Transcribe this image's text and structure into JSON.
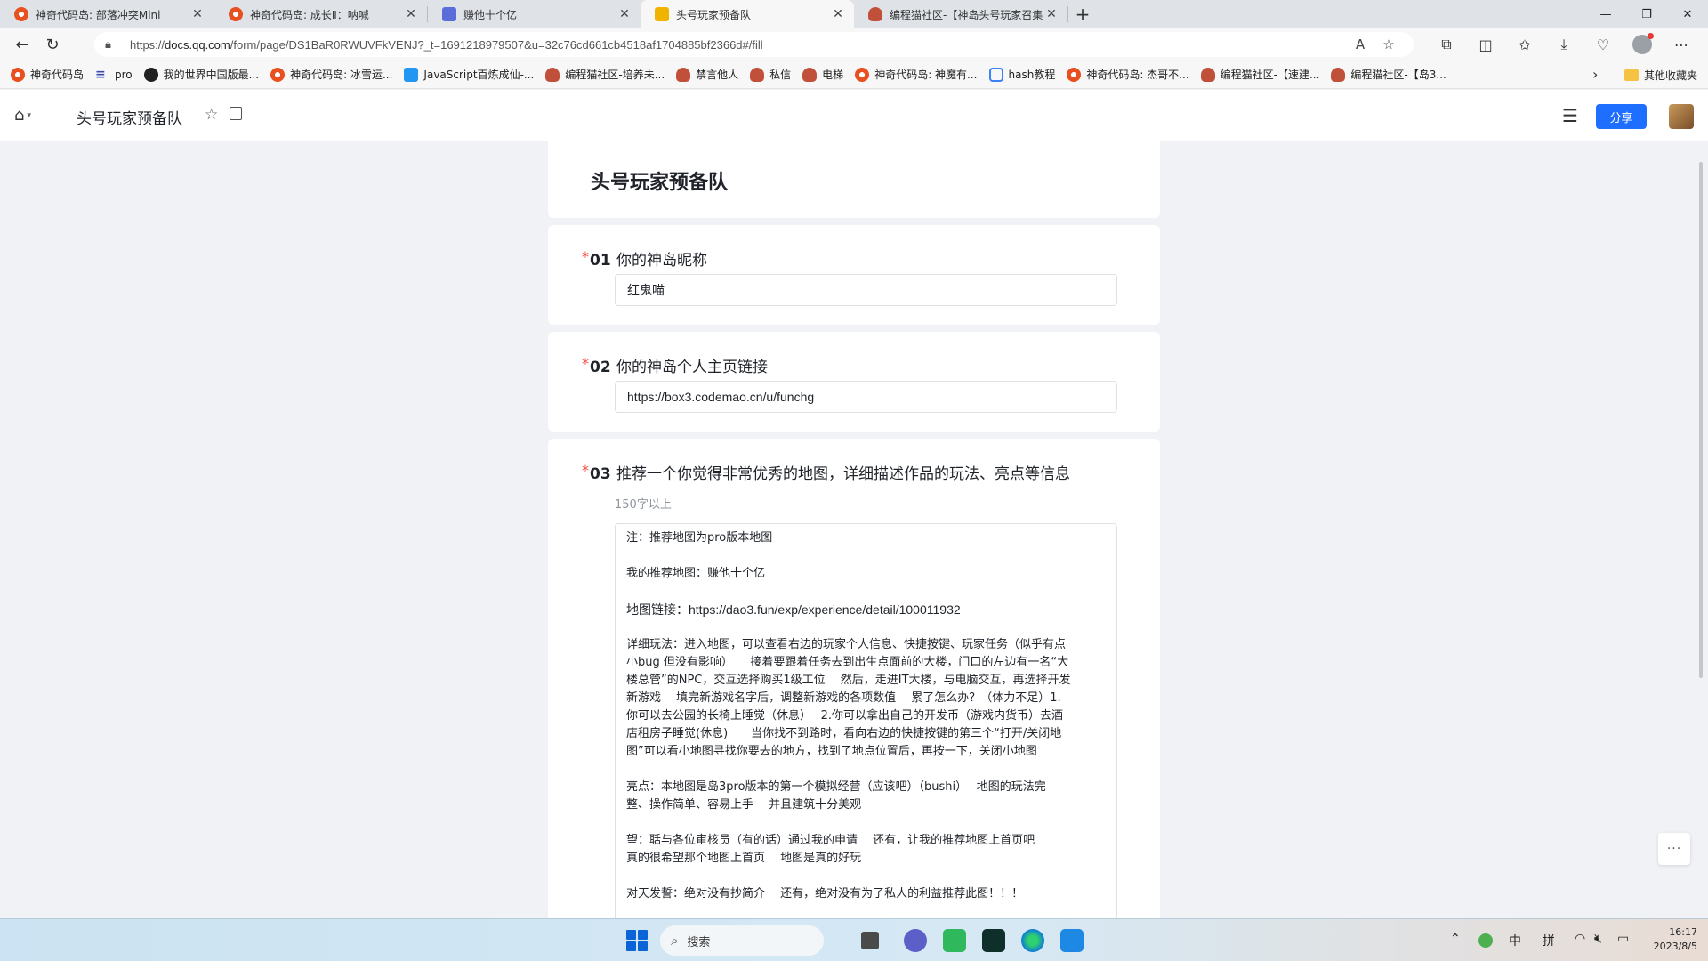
{
  "browser": {
    "tabs": [
      {
        "title": "神奇代码岛: 部落冲突Mini",
        "icon": "shendao-icon",
        "active": false
      },
      {
        "title": "神奇代码岛: 成长Ⅱ：呐喊",
        "icon": "shendao-icon",
        "active": false
      },
      {
        "title": "赚他十个亿",
        "icon": "doc-icon",
        "active": false
      },
      {
        "title": "头号玩家预备队",
        "icon": "tencent-docs-icon",
        "active": true
      },
      {
        "title": "编程猫社区-【神岛头号玩家召集",
        "icon": "codemao-icon",
        "active": false
      }
    ],
    "url_prefix": "https://",
    "url_domain": "docs.qq.com",
    "url_rest": "/form/page/DS1BaR0RWUVFkVENJ?_t=1691218979507&u=32c76cd661cb4518af1704885bf2366d#/fill",
    "bookmarks": [
      {
        "label": "神奇代码岛",
        "icon": "shendao-icon"
      },
      {
        "label": "pro",
        "icon": "pro-icon"
      },
      {
        "label": "我的世界中国版最...",
        "icon": "minecraft-icon"
      },
      {
        "label": "神奇代码岛: 冰雪运...",
        "icon": "shendao-icon"
      },
      {
        "label": "JavaScript百炼成仙-...",
        "icon": "js-icon"
      },
      {
        "label": "编程猫社区-培养未...",
        "icon": "codemao-icon"
      },
      {
        "label": "禁言他人",
        "icon": "codemao-icon"
      },
      {
        "label": "私信",
        "icon": "codemao-icon"
      },
      {
        "label": "电梯",
        "icon": "codemao-icon"
      },
      {
        "label": "神奇代码岛: 神魔有...",
        "icon": "shendao-icon"
      },
      {
        "label": "hash教程",
        "icon": "hash-icon"
      },
      {
        "label": "神奇代码岛: 杰哥不...",
        "icon": "shendao-icon"
      },
      {
        "label": "编程猫社区-【速建...",
        "icon": "codemao-icon"
      },
      {
        "label": "编程猫社区-【岛3...",
        "icon": "codemao-icon"
      }
    ],
    "other_bookmarks": "其他收藏夹"
  },
  "app": {
    "doc_title": "头号玩家预备队",
    "share_label": "分享"
  },
  "form": {
    "title": "头号玩家预备队",
    "questions": [
      {
        "num": "01",
        "label": "你的神岛昵称",
        "value": "红鬼喵"
      },
      {
        "num": "02",
        "label": "你的神岛个人主页链接",
        "value": "https://box3.codemao.cn/u/funchg"
      },
      {
        "num": "03",
        "label": "推荐一个你觉得非常优秀的地图，详细描述作品的玩法、亮点等信息",
        "hint": "150字以上"
      }
    ],
    "answer_lines": [
      "注：推荐地图为pro版本地图",
      "",
      "我的推荐地图：赚他十个亿",
      "",
      "地图链接：https://dao3.fun/exp/experience/detail/100011932",
      "",
      "详细玩法：进入地图，可以查看右边的玩家个人信息、快捷按键、玩家任务（似乎有点",
      "小bug 但没有影响）　　接着要跟着任务去到出生点面前的大楼，门口的左边有一名“大",
      "楼总管”的NPC，交互选择购买1级工位　 然后，走进IT大楼，与电脑交互，再选择开发",
      "新游戏　 填完新游戏名字后，调整新游戏的各项数值　 累了怎么办？（体力不足）1.",
      "你可以去公园的长椅上睡觉（休息）　 2.你可以拿出自己的开发币（游戏内货币）去酒",
      "店租房子睡觉(休息)　　当你找不到路时，看向右边的快捷按键的第三个“打开/关闭地",
      "图”可以看小地图寻找你要去的地方，找到了地点位置后，再按一下，关闭小地图",
      "",
      "亮点：本地图是岛3pro版本的第一个模拟经营（应该吧）（bushi）　 地图的玩法完",
      "整、操作简单、容易上手　 并且建筑十分美观",
      "",
      "望：聒与各位审核员（有的话）通过我的申请　 还有，让我的推荐地图上首页吧",
      "真的很希望那个地图上首页　 地图是真的好玩",
      "",
      "对天发誓：绝对没有抄简介　 还有，绝对没有为了私人的利益推荐此图！！！"
    ]
  },
  "taskbar": {
    "search_placeholder": "搜索",
    "ime_lang": "中",
    "ime_mode": "拼",
    "time": "16:17",
    "date": "2023/8/5"
  }
}
